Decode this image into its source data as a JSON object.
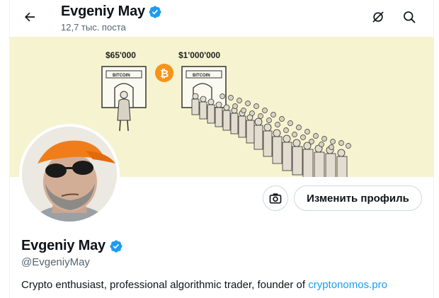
{
  "header": {
    "name": "Evgeniy May",
    "posts_count": "12,7 тыс. поста",
    "icons": [
      "back-arrow-icon",
      "pin-slash-icon",
      "search-icon"
    ]
  },
  "banner": {
    "label_left_amount": "$65'000",
    "label_right_amount": "$1'000'000",
    "sign_left": "BITCOIN",
    "sign_right": "BITCOIN",
    "coin_symbol": "₿"
  },
  "actions": {
    "camera_icon": "camera-icon",
    "edit_profile_label": "Изменить профиль"
  },
  "profile": {
    "name": "Evgeniy May",
    "handle": "@EvgeniyMay",
    "bio_text": "Crypto enthusiast, professional algorithmic trader, founder of ",
    "bio_link": "cryptonomos.pro"
  },
  "colors": {
    "verified": "#1d9bf0",
    "link": "#1d9bf0",
    "muted": "#536471",
    "banner_bg": "#f6f3d0",
    "coin": "#f7931a"
  }
}
